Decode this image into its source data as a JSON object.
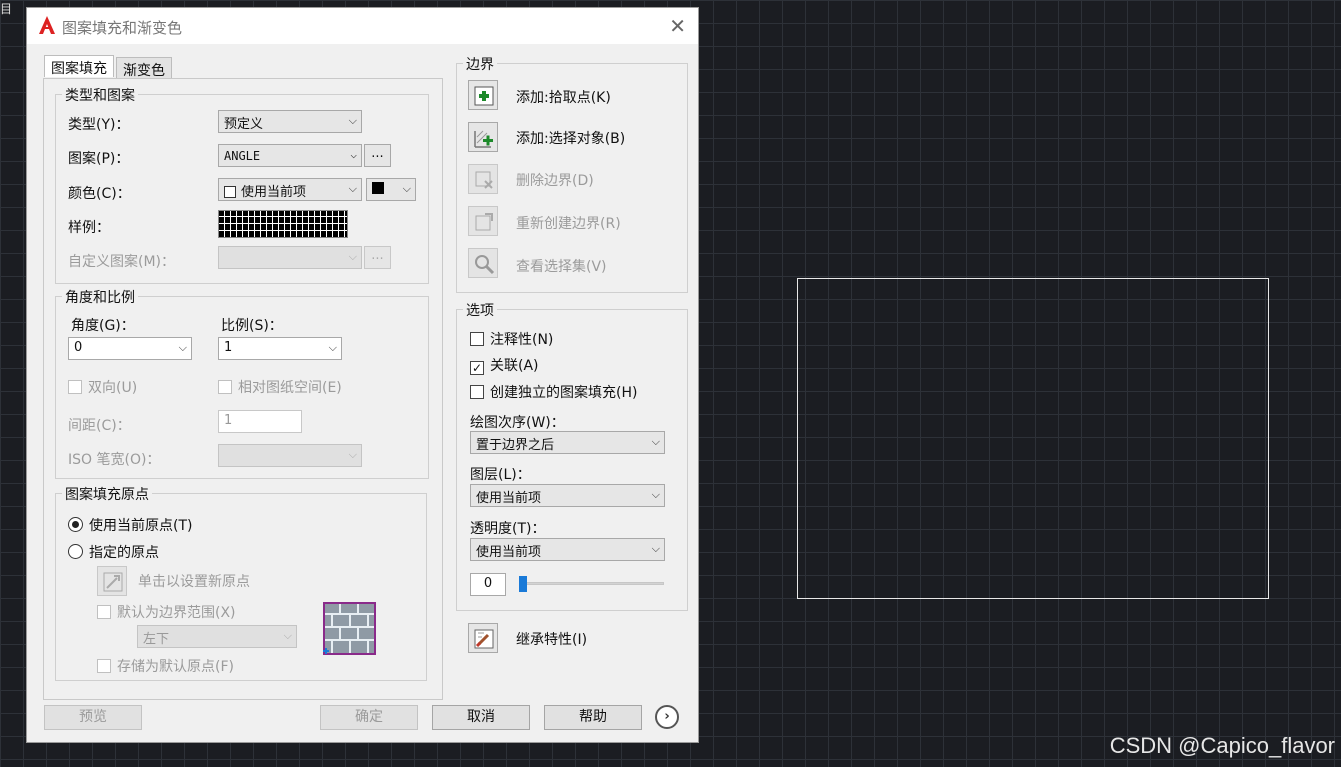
{
  "canvas": {
    "corner_text": "目",
    "watermark": "CSDN @Capico_flavor"
  },
  "dialog": {
    "title": "图案填充和渐变色",
    "close_glyph": "✕"
  },
  "tabs": [
    {
      "label": "图案填充"
    },
    {
      "label": "渐变色"
    }
  ],
  "type_pattern": {
    "title": "类型和图案",
    "type_label": "类型(Y)：",
    "type_value": "预定义",
    "pattern_label": "图案(P)：",
    "pattern_value": "ANGLE",
    "pattern_browse": "...",
    "color_label": "颜色(C)：",
    "color_value": "使用当前项",
    "sample_label": "样例：",
    "custom_label": "自定义图案(M)：",
    "custom_browse": "..."
  },
  "angle_scale": {
    "title": "角度和比例",
    "angle_label": "角度(G)：",
    "angle_value": "0",
    "scale_label": "比例(S)：",
    "scale_value": "1",
    "double_label": "双向(U)",
    "relative_label": "相对图纸空间(E)",
    "spacing_label": "间距(C)：",
    "spacing_value": "1",
    "iso_label": "ISO 笔宽(O)："
  },
  "origin": {
    "title": "图案填充原点",
    "use_current_label": "使用当前原点(T)",
    "specified_label": "指定的原点",
    "click_set_label": "单击以设置新原点",
    "default_extent_label": "默认为边界范围(X)",
    "extent_value": "左下",
    "store_default_label": "存储为默认原点(F)"
  },
  "boundaries": {
    "title": "边界",
    "add_pick": "添加:拾取点(K)",
    "add_select": "添加:选择对象(B)",
    "remove": "删除边界(D)",
    "recreate": "重新创建边界(R)",
    "view_selection": "查看选择集(V)"
  },
  "options": {
    "title": "选项",
    "annotative": "注释性(N)",
    "associative": "关联(A)",
    "separate": "创建独立的图案填充(H)",
    "draw_order_label": "绘图次序(W)：",
    "draw_order_value": "置于边界之后",
    "layer_label": "图层(L)：",
    "layer_value": "使用当前项",
    "transparency_label": "透明度(T)：",
    "transparency_value": "使用当前项",
    "transparency_level": "0"
  },
  "inherit_label": "继承特性(I)",
  "footer": {
    "preview": "预览",
    "ok": "确定",
    "cancel": "取消",
    "help": "帮助",
    "more": "›"
  }
}
